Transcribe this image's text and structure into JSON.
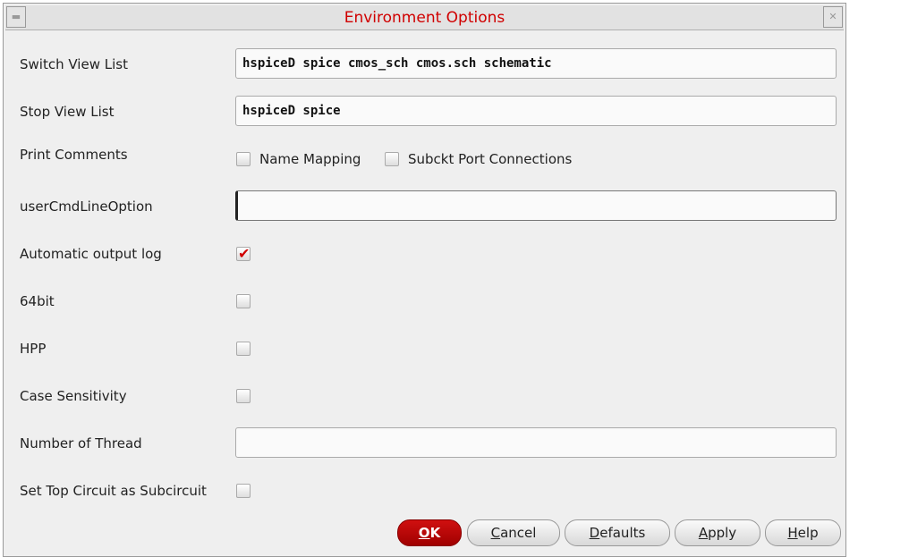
{
  "window": {
    "title": "Environment Options"
  },
  "fields": {
    "switch_view_list": {
      "label": "Switch View List",
      "value": "hspiceD spice cmos_sch cmos.sch schematic"
    },
    "stop_view_list": {
      "label": "Stop View List",
      "value": "hspiceD spice"
    },
    "print_comments": {
      "label": "Print Comments",
      "name_mapping": "Name Mapping",
      "subckt_port": "Subckt Port Connections"
    },
    "user_cmd_line_option": {
      "label": "userCmdLineOption",
      "value": ""
    },
    "automatic_output_log": {
      "label": "Automatic output log",
      "checked": true
    },
    "bit64": {
      "label": "64bit",
      "checked": false
    },
    "hpp": {
      "label": "HPP",
      "checked": false
    },
    "case_sensitivity": {
      "label": "Case Sensitivity",
      "checked": false
    },
    "number_of_thread": {
      "label": "Number of Thread",
      "value": ""
    },
    "set_top_circuit": {
      "label": "Set Top Circuit as Subcircuit",
      "checked": false
    }
  },
  "buttons": {
    "ok": {
      "u": "O",
      "rest": "K"
    },
    "cancel": {
      "u": "C",
      "rest": "ancel"
    },
    "defaults": {
      "u": "D",
      "rest": "efaults"
    },
    "apply": {
      "u": "A",
      "rest": "pply"
    },
    "help": {
      "u": "H",
      "rest": "elp"
    }
  }
}
